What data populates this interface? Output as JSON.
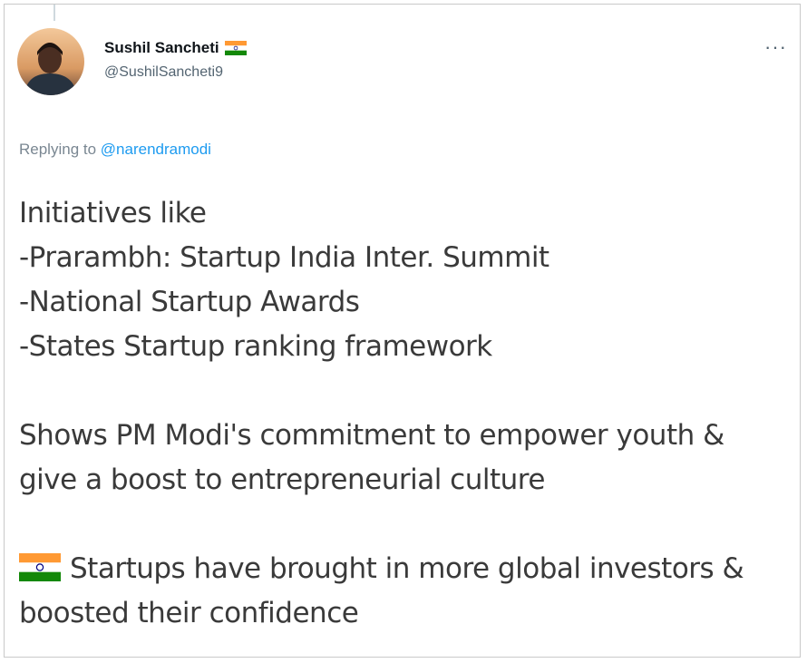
{
  "tweet": {
    "author": {
      "display_name": "Sushil Sancheti",
      "handle": "@SushilSancheti9",
      "badge_icon": "india-flag-icon"
    },
    "more_label": "···",
    "reply": {
      "prefix": "Replying to",
      "mention": "@narendramodi"
    },
    "body": {
      "line1": "Initiatives like",
      "line2": "-Prarambh: Startup India Inter. Summit",
      "line3": "-National Startup Awards",
      "line4": "-States Startup ranking framework",
      "line5": "Shows PM Modi's commitment to empower youth &",
      "line6": "give a boost to entrepreneurial culture",
      "line7": "Startups have brought in more global investors &",
      "line8": "boosted their confidence"
    }
  },
  "colors": {
    "link": "#1d9bf0",
    "saffron": "#ff9933",
    "green": "#138808",
    "chakra": "#000080"
  }
}
